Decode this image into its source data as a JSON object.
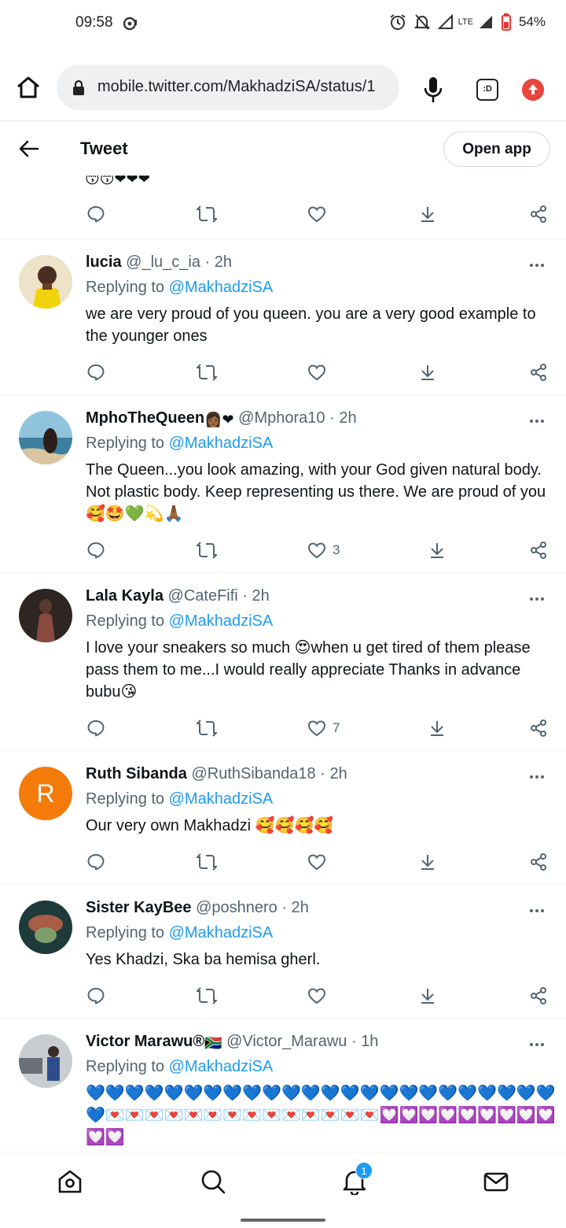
{
  "status_bar": {
    "time": "09:58",
    "network": "LTE",
    "battery": "54%",
    "icons": [
      "alarm-icon",
      "mute-icon",
      "signal-icon",
      "battery-icon"
    ]
  },
  "browser": {
    "url": "mobile.twitter.com/MakhadziSA/status/1",
    "dex_label": ":D"
  },
  "header": {
    "title": "Tweet",
    "open_app": "Open app"
  },
  "partial_tweet": {
    "emojis": "😙😙❤❤❤"
  },
  "replies": [
    {
      "name": "lucia",
      "name_emoji": "",
      "handle": "@_lu_c_ia",
      "time": "2h",
      "replying_label": "Replying to",
      "replying_handle": "@MakhadziSA",
      "text": "we are very proud of you queen. you are a very good example to the younger ones",
      "likes": "",
      "avatar_color": "#c7b27a"
    },
    {
      "name": "MphoTheQueen",
      "name_emoji": "👩🏾❤",
      "handle": "@Mphora10",
      "time": "2h",
      "replying_label": "Replying to",
      "replying_handle": "@MakhadziSA",
      "text": "The Queen...you look amazing,  with your God given natural body. Not plastic body. Keep representing us there. We are proud of you🥰🤩💚💫🙏🏾",
      "likes": "3",
      "avatar_color": "#6fa7c3"
    },
    {
      "name": "Lala Kayla",
      "name_emoji": "",
      "handle": "@CateFifi",
      "time": "2h",
      "replying_label": "Replying to",
      "replying_handle": "@MakhadziSA",
      "text": "I love your sneakers so much 😍when u get tired of them please pass them to me...I would really appreciate Thanks in advance bubu😘",
      "likes": "7",
      "avatar_color": "#4a3a36"
    },
    {
      "name": "Ruth Sibanda",
      "name_emoji": "",
      "handle": "@RuthSibanda18",
      "time": "2h",
      "replying_label": "Replying to",
      "replying_handle": "@MakhadziSA",
      "text": "Our very own Makhadzi 🥰🥰🥰🥰",
      "likes": "",
      "avatar_letter": "R",
      "avatar_color": "#f47b0a"
    },
    {
      "name": "Sister KayBee",
      "name_emoji": "",
      "handle": "@poshnero",
      "time": "2h",
      "replying_label": "Replying to",
      "replying_handle": "@MakhadziSA",
      "text": "Yes Khadzi, Ska ba hemisa gherl.",
      "likes": "",
      "avatar_color": "#7b4a3b"
    },
    {
      "name": "Victor Marawu®",
      "name_emoji": "🇿🇦",
      "handle": "@Victor_Marawu",
      "time": "1h",
      "replying_label": "Replying to",
      "replying_handle": "@MakhadziSA",
      "text": "💙💙💙💙💙💙💙💙💙💙💙💙💙💙💙💙💙💙💙💙💙💙💙💙💙💌💌💌💌💌💌💌💌💌💌💌💌💌💌💟💟💟💟💟💟💟💟💟💟💟",
      "likes": "",
      "avatar_color": "#8a8f96"
    }
  ],
  "bottom_nav": {
    "notification_count": "1",
    "items": [
      "home-icon",
      "search-icon",
      "notifications-icon",
      "messages-icon"
    ]
  },
  "colors": {
    "accent": "#1d9bf0",
    "text": "#0f1419",
    "muted": "#536471",
    "divider": "#eff3f4"
  }
}
